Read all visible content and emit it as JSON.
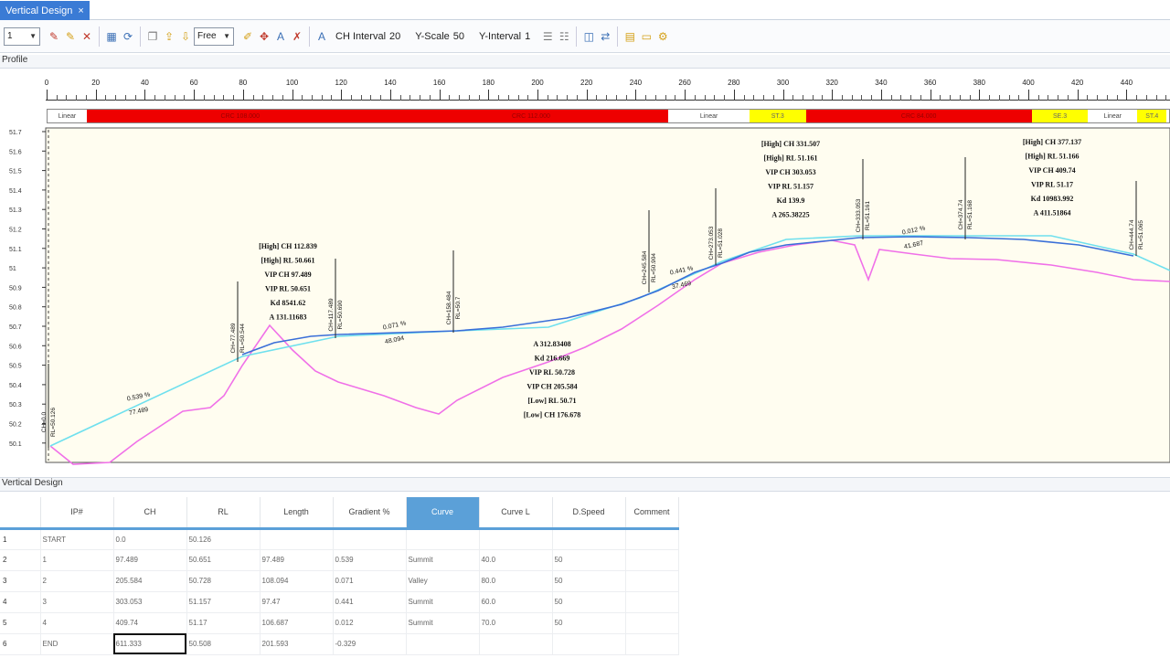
{
  "tab": {
    "title": "Vertical Design",
    "close": "×"
  },
  "toolbar": {
    "layer_combo": "1",
    "mode_combo": "Free",
    "ch_interval_label": "CH Interval",
    "ch_interval_value": "20",
    "y_scale_label": "Y-Scale",
    "y_scale_value": "50",
    "y_interval_label": "Y-Interval",
    "y_interval_value": "1"
  },
  "profile_label": "Profile",
  "ruler_ticks": [
    "0",
    "20",
    "40",
    "60",
    "80",
    "100",
    "120",
    "140",
    "160",
    "180",
    "200",
    "220",
    "240",
    "260",
    "280",
    "300",
    "320",
    "340",
    "360",
    "380",
    "400",
    "420",
    "440"
  ],
  "curve_bar": [
    {
      "type": "linear",
      "label": "Linear",
      "from": 0,
      "to": 16
    },
    {
      "type": "red",
      "label": "CRC 108.000",
      "from": 16,
      "to": 141
    },
    {
      "type": "red",
      "label": "CRC 112.000",
      "from": 141,
      "to": 253
    },
    {
      "type": "linear",
      "label": "Linear",
      "from": 253,
      "to": 286
    },
    {
      "type": "yellow",
      "label": "ST.3",
      "from": 286,
      "to": 309
    },
    {
      "type": "red",
      "label": "CRC 84.000",
      "from": 309,
      "to": 401
    },
    {
      "type": "yellow",
      "label": "SE.3",
      "from": 401,
      "to": 424
    },
    {
      "type": "linear",
      "label": "Linear",
      "from": 424,
      "to": 444
    },
    {
      "type": "yellow",
      "label": "ST.4",
      "from": 444,
      "to": 456
    }
  ],
  "profile": {
    "y_ticks": [
      "51.7",
      "51.6",
      "51.5",
      "51.4",
      "51.3",
      "51.2",
      "51.1",
      "51",
      "50.9",
      "50.8",
      "50.7",
      "50.6",
      "50.5",
      "50.4",
      "50.3",
      "50.2",
      "50.1"
    ],
    "vertical_markers": [
      {
        "label1": "CH=0.0",
        "label2": "RL=50.126"
      },
      {
        "label1": "CH=77.489",
        "label2": "RL=50.544"
      },
      {
        "label1": "CH=117.489",
        "label2": "RL=50.690"
      },
      {
        "label1": "CH=158.484",
        "label2": "RL=50.7"
      },
      {
        "label1": "CH=245.584",
        "label2": "RL=50.904"
      },
      {
        "label1": "CH=273.053",
        "label2": "RL=51.028"
      },
      {
        "label1": "CH=333.053",
        "label2": "RL=51.161"
      },
      {
        "label1": "CH=374.74",
        "label2": "RL=51.168"
      },
      {
        "label1": "CH=444.74",
        "label2": "RL=51.065"
      }
    ],
    "grade_labels": [
      {
        "pct": "0.539 %",
        "len": "77.489"
      },
      {
        "pct": "0.071 %",
        "len": "48.094"
      },
      {
        "pct": "0.441 %",
        "len": "37.469"
      },
      {
        "pct": "0.012 %",
        "len": "41.687"
      }
    ],
    "annotations": [
      [
        "[High] CH 112.839",
        "[High] RL 50.661",
        "VIP CH 97.489",
        "VIP RL 50.651",
        "Kd 8541.62",
        "A 131.11683"
      ],
      [
        "A 312.83408",
        "Kd 216.669",
        "VIP RL 50.728",
        "VIP CH 205.584",
        "[Low] RL 50.71",
        "[Low] CH 176.678"
      ],
      [
        "[High] CH 331.507",
        "[High] RL 51.161",
        "VIP CH 303.053",
        "VIP RL 51.157",
        "Kd 139.9",
        "A 265.38225"
      ],
      [
        "[High] CH 377.137",
        "[High] RL 51.166",
        "VIP CH 409.74",
        "VIP RL 51.17",
        "Kd 10983.992",
        "A 411.51864"
      ]
    ]
  },
  "vertical_design_label": "Vertical Design",
  "table": {
    "headers": [
      "IP#",
      "CH",
      "RL",
      "Length",
      "Gradient %",
      "Curve",
      "Curve L",
      "D.Speed",
      "Comment"
    ],
    "selected_header": "Curve",
    "rows": [
      [
        "1",
        "START",
        "0.0",
        "50.126",
        "",
        "",
        "",
        "",
        "",
        ""
      ],
      [
        "2",
        "1",
        "97.489",
        "50.651",
        "97.489",
        "0.539",
        "Summit",
        "40.0",
        "50",
        ""
      ],
      [
        "3",
        "2",
        "205.584",
        "50.728",
        "108.094",
        "0.071",
        "Valley",
        "80.0",
        "50",
        ""
      ],
      [
        "4",
        "3",
        "303.053",
        "51.157",
        "97.47",
        "0.441",
        "Summit",
        "60.0",
        "50",
        ""
      ],
      [
        "5",
        "4",
        "409.74",
        "51.17",
        "106.687",
        "0.012",
        "Summit",
        "70.0",
        "50",
        ""
      ],
      [
        "6",
        "END",
        "611.333",
        "50.508",
        "201.593",
        "-0.329",
        "",
        "",
        "",
        ""
      ]
    ]
  },
  "colors": {
    "design_line": "#3a6fd8",
    "tangent_line": "#6fe0ee",
    "ground_line": "#f070e8",
    "plot_bg": "#fffdf0",
    "curve_red": "#ee0000",
    "curve_yellow": "#ffff00"
  }
}
